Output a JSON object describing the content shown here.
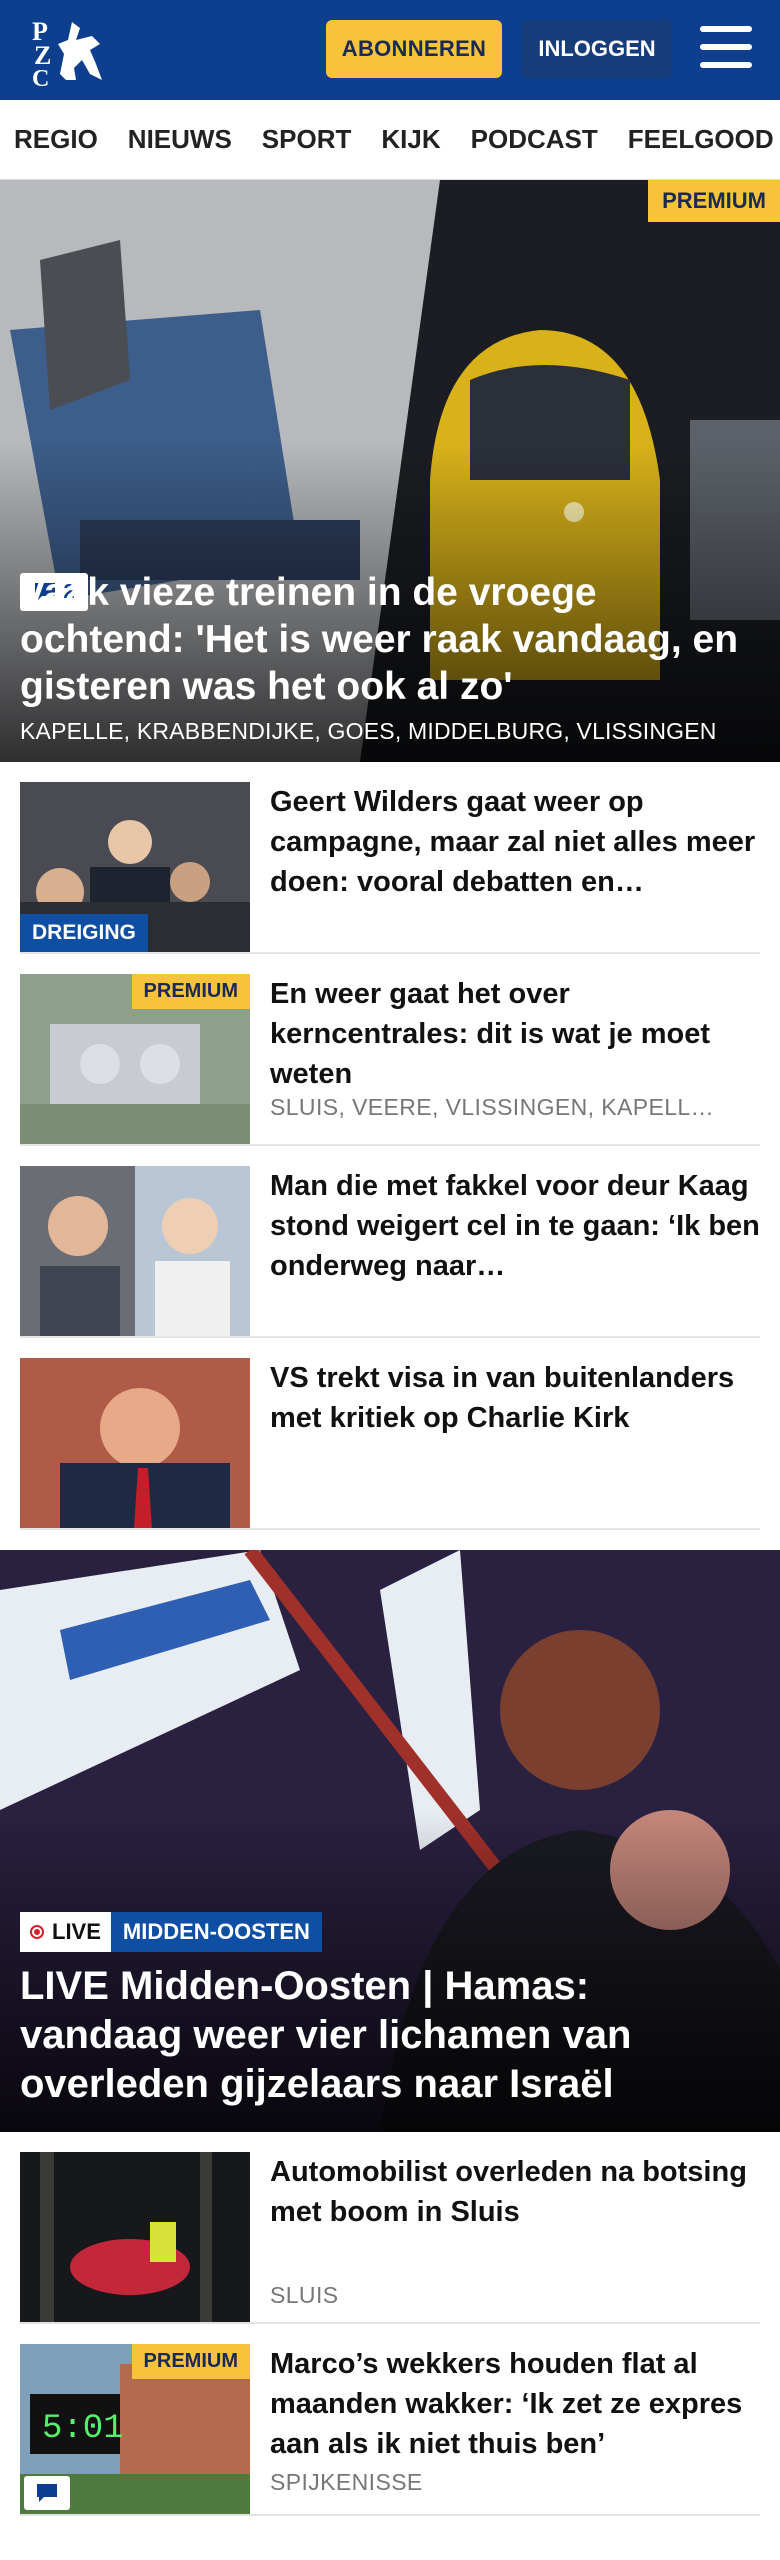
{
  "header": {
    "logo_text": "PZC",
    "subscribe_label": "ABONNEREN",
    "login_label": "INLOGGEN"
  },
  "nav": [
    "REGIO",
    "NIEUWS",
    "SPORT",
    "KIJK",
    "PODCAST",
    "FEELGOOD"
  ],
  "hero": {
    "badge": "PREMIUM",
    "comment_count": "2",
    "title": "Vaak vieze treinen in de vroege ochtend: 'Het is weer raak vandaag, en gisteren was het ook al zo'",
    "tags": "KAPELLE, KRABBENDIJKE, GOES, MIDDELBURG, VLISSINGEN"
  },
  "articles": [
    {
      "title": "Geert Wilders gaat weer op campagne, maar zal niet alles meer doen: vooral debatten en…",
      "tag": "DREIGING"
    },
    {
      "title": "En weer gaat het over kerncentrales: dit is wat je moet weten",
      "badge": "PREMIUM",
      "meta": "SLUIS, VEERE, VLISSINGEN, KAPELL…"
    },
    {
      "title": "Man die met fakkel voor deur Kaag stond weigert cel in te gaan: ‘Ik ben onderweg naar…"
    },
    {
      "title": "VS trekt visa in van buitenlanders met kritiek op Charlie Kirk"
    }
  ],
  "hero2": {
    "live_label": "LIVE",
    "section": "MIDDEN-OOSTEN",
    "title": "LIVE Midden-Oosten | Hamas: vandaag weer vier lichamen van overleden gijzelaars naar Israël"
  },
  "articles2": [
    {
      "title": "Automobilist overleden na botsing met boom in Sluis",
      "meta": "SLUIS"
    },
    {
      "title": "Marco’s wekkers houden flat al maanden wakker: ‘Ik zet ze expres aan als ik niet thuis ben’",
      "badge": "PREMIUM",
      "meta": "SPIJKENISSE",
      "clock": "5:01"
    }
  ],
  "colors": {
    "brand": "#0e3f8f",
    "accent": "#f6c33b",
    "tag_blue": "#0e4fa3"
  }
}
